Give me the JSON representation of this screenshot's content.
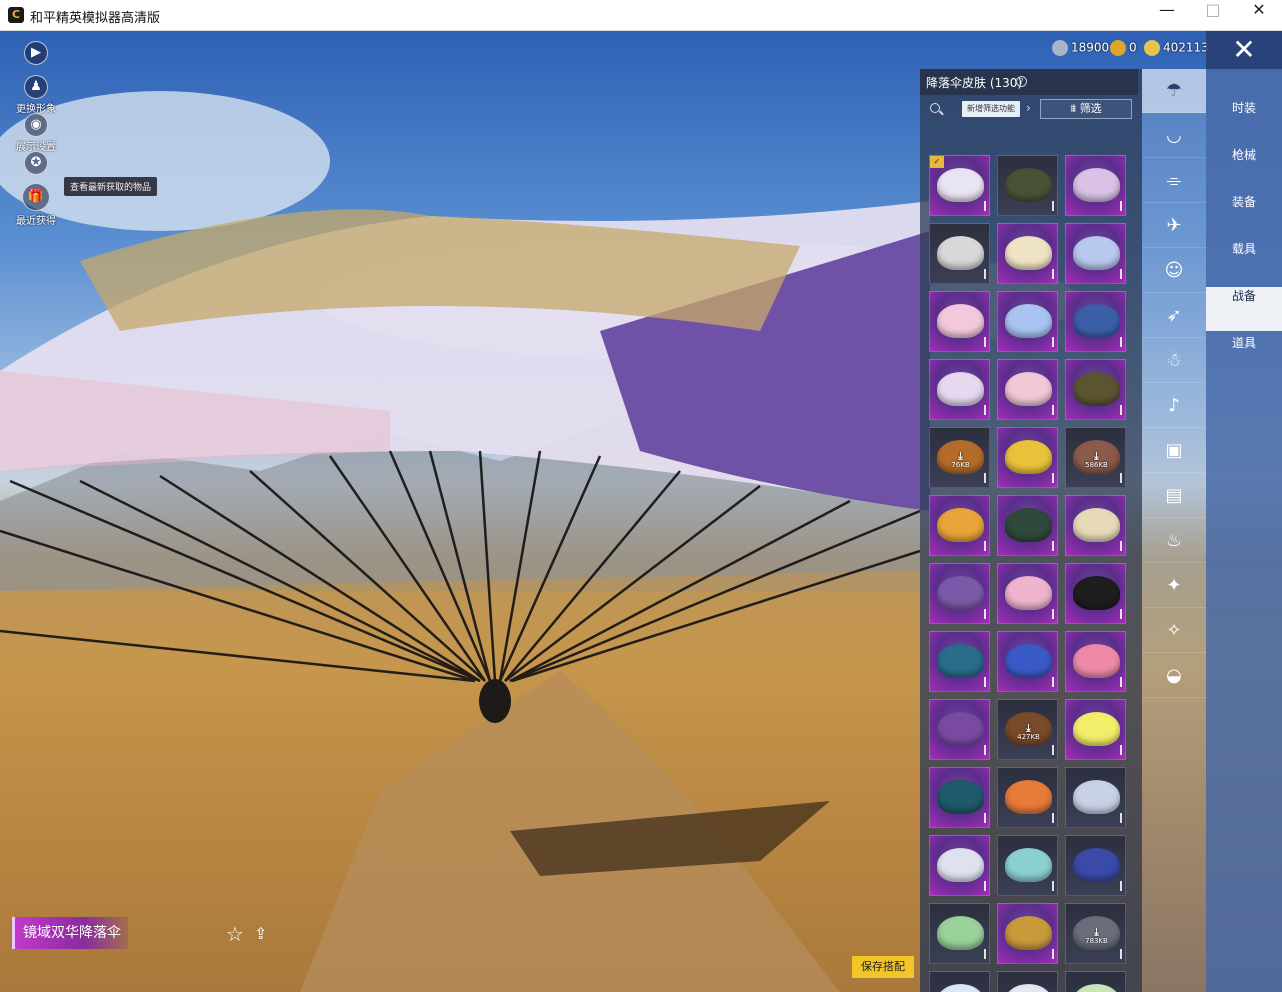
{
  "window": {
    "title": "和平精英模拟器高清版",
    "icon_text": "C",
    "minimize": "—",
    "maximize": "□",
    "close": "✕"
  },
  "left_tools": [
    {
      "label": "更换形象",
      "icon": "person-icon",
      "glyph": "♟"
    },
    {
      "label": "展示设置",
      "icon": "eye-icon",
      "glyph": "◉"
    },
    {
      "label": "",
      "icon": "badge-icon",
      "glyph": "✪"
    },
    {
      "label": "最近获得",
      "icon": "gift-icon",
      "glyph": "🎁"
    }
  ],
  "expand_glyph": "▶",
  "tooltip": "查看最新获取的物品",
  "currency": [
    {
      "value": "18900",
      "color": "#aab4c8"
    },
    {
      "value": "0",
      "color": "#e0a52a"
    },
    {
      "value": "402113",
      "color": "#e8c54a"
    }
  ],
  "panel": {
    "title": "降落伞皮肤 (130)",
    "help": "?",
    "new_filter": "新增筛选功能",
    "arrow": "›",
    "filter": "筛选"
  },
  "tiles": [
    {
      "bg": "purple",
      "chute": "#e9e4f2",
      "badge": "✓"
    },
    {
      "bg": "dark",
      "chute": "#4a5236"
    },
    {
      "bg": "purple",
      "chute": "#d9c2e6"
    },
    {
      "bg": "dark",
      "chute": "#d8d8d8"
    },
    {
      "bg": "purple",
      "chute": "#efe3c5"
    },
    {
      "bg": "purple",
      "chute": "#b9c8ee"
    },
    {
      "bg": "purple",
      "chute": "#f2c9dc"
    },
    {
      "bg": "purple",
      "chute": "#a9c4f0"
    },
    {
      "bg": "purple",
      "chute": "#3b5fa8"
    },
    {
      "bg": "purple",
      "chute": "#e6d8ef"
    },
    {
      "bg": "purple",
      "chute": "#f0c8d6"
    },
    {
      "bg": "purple",
      "chute": "#5b5432"
    },
    {
      "bg": "dark",
      "chute": "#b56c2a",
      "download": "76KB"
    },
    {
      "bg": "purple",
      "chute": "#e8c23a"
    },
    {
      "bg": "dark",
      "chute": "#8a5a4a",
      "download": "586KB"
    },
    {
      "bg": "purple",
      "chute": "#e9a43a"
    },
    {
      "bg": "purple",
      "chute": "#2f4a3a"
    },
    {
      "bg": "purple",
      "chute": "#e6d9b8"
    },
    {
      "bg": "purple",
      "chute": "#7a5aa8"
    },
    {
      "bg": "purple",
      "chute": "#f0b3cc"
    },
    {
      "bg": "purple",
      "chute": "#1e1e1e"
    },
    {
      "bg": "purple",
      "chute": "#2a6c8a"
    },
    {
      "bg": "purple",
      "chute": "#3a5ac8"
    },
    {
      "bg": "purple",
      "chute": "#ee8aa8"
    },
    {
      "bg": "purple",
      "chute": "#7a4aa0"
    },
    {
      "bg": "dark",
      "chute": "#7a4a2a",
      "download": "427KB"
    },
    {
      "bg": "purple",
      "chute": "#f2ee6a"
    },
    {
      "bg": "purple",
      "chute": "#1f5a6a"
    },
    {
      "bg": "dark",
      "chute": "#e87a3a"
    },
    {
      "bg": "dark",
      "chute": "#c8d2e6"
    },
    {
      "bg": "purple",
      "chute": "#dfe2ee"
    },
    {
      "bg": "dark",
      "chute": "#8ad0d0"
    },
    {
      "bg": "dark",
      "chute": "#3a4aa8"
    },
    {
      "bg": "dark",
      "chute": "#9ad09a"
    },
    {
      "bg": "purple",
      "chute": "#c89a3a"
    },
    {
      "bg": "dark",
      "chute": "#6a6e7a",
      "download": "783KB"
    },
    {
      "bg": "dark",
      "chute": "#d8e8f6"
    },
    {
      "bg": "dark",
      "chute": "#e6e6f0"
    },
    {
      "bg": "dark",
      "chute": "#c8e6b8"
    }
  ],
  "rail_icons": [
    "parachute-icon",
    "eye-wing-icon",
    "drone-icon",
    "plane-icon",
    "emote-icon",
    "glider-icon",
    "robot-icon",
    "speaker-icon",
    "box-icon",
    "photo-icon",
    "extinguisher-icon",
    "spark-icon",
    "wand-icon",
    "tail-icon"
  ],
  "rail_glyphs": [
    "☂",
    "◡",
    "⌯",
    "✈",
    "☺",
    "➶",
    "☃",
    "♪",
    "▣",
    "▤",
    "♨",
    "✦",
    "✧",
    "◒"
  ],
  "menu": [
    "时装",
    "枪械",
    "装备",
    "载具",
    "战备",
    "道具"
  ],
  "menu_active": "战备",
  "close_panel": "✕",
  "item_name": "镜域双华降落伞",
  "star": "☆",
  "share": "⇪",
  "save": "保存搭配"
}
